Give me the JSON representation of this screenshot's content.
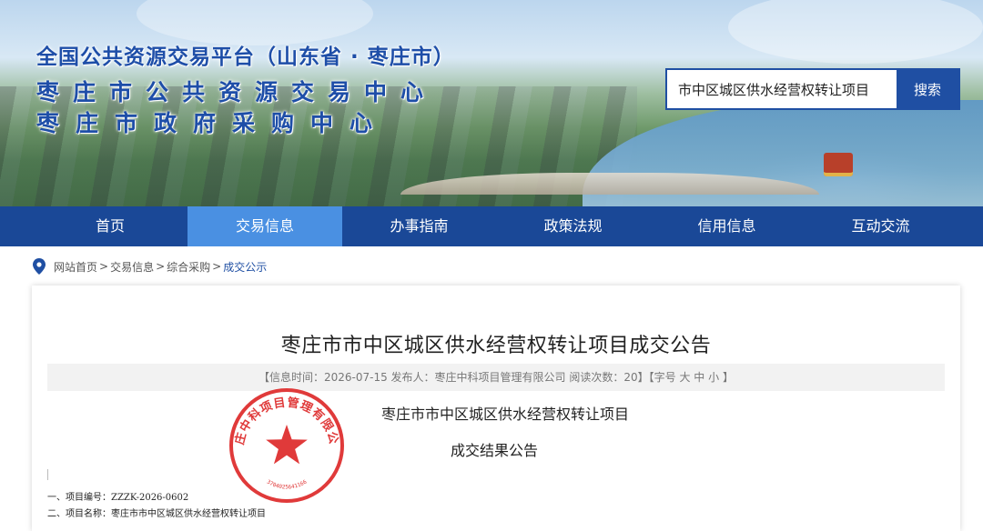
{
  "banner": {
    "title_line1": "全国公共资源交易平台（山东省 · 枣庄市）",
    "title_line2": "枣庄市公共资源交易中心",
    "title_line3": "枣庄市政府采购中心"
  },
  "search": {
    "value": "市中区城区供水经营权转让项目",
    "button_label": "搜索"
  },
  "nav": {
    "items": [
      {
        "label": "首页"
      },
      {
        "label": "交易信息"
      },
      {
        "label": "办事指南"
      },
      {
        "label": "政策法规"
      },
      {
        "label": "信用信息"
      },
      {
        "label": "互动交流"
      }
    ]
  },
  "breadcrumb": {
    "items": [
      "网站首页",
      "交易信息",
      "综合采购"
    ],
    "current": "成交公示",
    "separator": ">"
  },
  "article": {
    "title": "枣庄市市中区城区供水经营权转让项目成交公告",
    "meta_text": "【信息时间：2026-07-15   发布人：枣庄中科项目管理有限公司   阅读次数：20】【字号",
    "font_sizes": [
      "大",
      "中",
      "小"
    ],
    "meta_close": "】",
    "body_line1": "枣庄市市中区城区供水经营权转让项目",
    "body_line2": "成交结果公告",
    "item1": "一、项目编号：ZZZK-2026-0602",
    "item2": "二、项目名称：枣庄市市中区城区供水经营权转让项目"
  },
  "stamp": {
    "org_name": "枣庄中科项目管理有限公司",
    "code": "3704025641166",
    "color": "#e03a3a"
  },
  "colors": {
    "nav_bg": "#1a4897",
    "nav_active": "#4a90e2",
    "title_blue": "#1e4ea8"
  }
}
